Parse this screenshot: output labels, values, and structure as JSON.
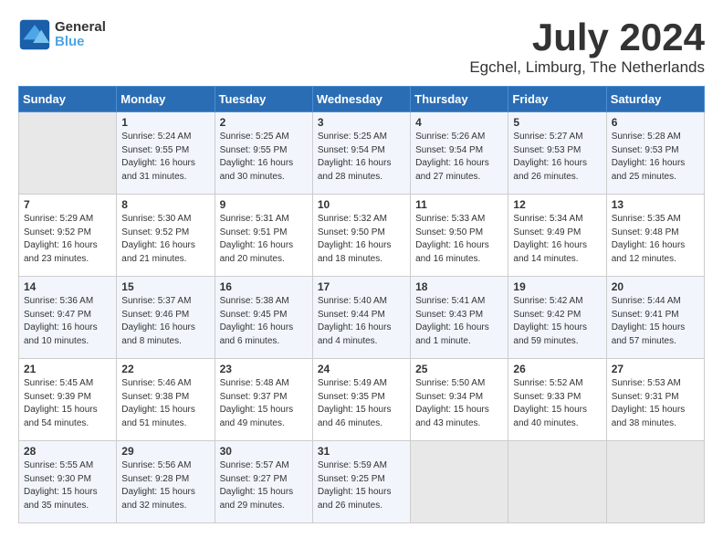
{
  "header": {
    "logo_line1": "General",
    "logo_line2": "Blue",
    "month_year": "July 2024",
    "location": "Egchel, Limburg, The Netherlands"
  },
  "days_of_week": [
    "Sunday",
    "Monday",
    "Tuesday",
    "Wednesday",
    "Thursday",
    "Friday",
    "Saturday"
  ],
  "weeks": [
    [
      {
        "day": "",
        "empty": true
      },
      {
        "day": "1",
        "sunrise": "5:24 AM",
        "sunset": "9:55 PM",
        "daylight": "16 hours and 31 minutes."
      },
      {
        "day": "2",
        "sunrise": "5:25 AM",
        "sunset": "9:55 PM",
        "daylight": "16 hours and 30 minutes."
      },
      {
        "day": "3",
        "sunrise": "5:25 AM",
        "sunset": "9:54 PM",
        "daylight": "16 hours and 28 minutes."
      },
      {
        "day": "4",
        "sunrise": "5:26 AM",
        "sunset": "9:54 PM",
        "daylight": "16 hours and 27 minutes."
      },
      {
        "day": "5",
        "sunrise": "5:27 AM",
        "sunset": "9:53 PM",
        "daylight": "16 hours and 26 minutes."
      },
      {
        "day": "6",
        "sunrise": "5:28 AM",
        "sunset": "9:53 PM",
        "daylight": "16 hours and 25 minutes."
      }
    ],
    [
      {
        "day": "7",
        "sunrise": "5:29 AM",
        "sunset": "9:52 PM",
        "daylight": "16 hours and 23 minutes."
      },
      {
        "day": "8",
        "sunrise": "5:30 AM",
        "sunset": "9:52 PM",
        "daylight": "16 hours and 21 minutes."
      },
      {
        "day": "9",
        "sunrise": "5:31 AM",
        "sunset": "9:51 PM",
        "daylight": "16 hours and 20 minutes."
      },
      {
        "day": "10",
        "sunrise": "5:32 AM",
        "sunset": "9:50 PM",
        "daylight": "16 hours and 18 minutes."
      },
      {
        "day": "11",
        "sunrise": "5:33 AM",
        "sunset": "9:50 PM",
        "daylight": "16 hours and 16 minutes."
      },
      {
        "day": "12",
        "sunrise": "5:34 AM",
        "sunset": "9:49 PM",
        "daylight": "16 hours and 14 minutes."
      },
      {
        "day": "13",
        "sunrise": "5:35 AM",
        "sunset": "9:48 PM",
        "daylight": "16 hours and 12 minutes."
      }
    ],
    [
      {
        "day": "14",
        "sunrise": "5:36 AM",
        "sunset": "9:47 PM",
        "daylight": "16 hours and 10 minutes."
      },
      {
        "day": "15",
        "sunrise": "5:37 AM",
        "sunset": "9:46 PM",
        "daylight": "16 hours and 8 minutes."
      },
      {
        "day": "16",
        "sunrise": "5:38 AM",
        "sunset": "9:45 PM",
        "daylight": "16 hours and 6 minutes."
      },
      {
        "day": "17",
        "sunrise": "5:40 AM",
        "sunset": "9:44 PM",
        "daylight": "16 hours and 4 minutes."
      },
      {
        "day": "18",
        "sunrise": "5:41 AM",
        "sunset": "9:43 PM",
        "daylight": "16 hours and 1 minute."
      },
      {
        "day": "19",
        "sunrise": "5:42 AM",
        "sunset": "9:42 PM",
        "daylight": "15 hours and 59 minutes."
      },
      {
        "day": "20",
        "sunrise": "5:44 AM",
        "sunset": "9:41 PM",
        "daylight": "15 hours and 57 minutes."
      }
    ],
    [
      {
        "day": "21",
        "sunrise": "5:45 AM",
        "sunset": "9:39 PM",
        "daylight": "15 hours and 54 minutes."
      },
      {
        "day": "22",
        "sunrise": "5:46 AM",
        "sunset": "9:38 PM",
        "daylight": "15 hours and 51 minutes."
      },
      {
        "day": "23",
        "sunrise": "5:48 AM",
        "sunset": "9:37 PM",
        "daylight": "15 hours and 49 minutes."
      },
      {
        "day": "24",
        "sunrise": "5:49 AM",
        "sunset": "9:35 PM",
        "daylight": "15 hours and 46 minutes."
      },
      {
        "day": "25",
        "sunrise": "5:50 AM",
        "sunset": "9:34 PM",
        "daylight": "15 hours and 43 minutes."
      },
      {
        "day": "26",
        "sunrise": "5:52 AM",
        "sunset": "9:33 PM",
        "daylight": "15 hours and 40 minutes."
      },
      {
        "day": "27",
        "sunrise": "5:53 AM",
        "sunset": "9:31 PM",
        "daylight": "15 hours and 38 minutes."
      }
    ],
    [
      {
        "day": "28",
        "sunrise": "5:55 AM",
        "sunset": "9:30 PM",
        "daylight": "15 hours and 35 minutes."
      },
      {
        "day": "29",
        "sunrise": "5:56 AM",
        "sunset": "9:28 PM",
        "daylight": "15 hours and 32 minutes."
      },
      {
        "day": "30",
        "sunrise": "5:57 AM",
        "sunset": "9:27 PM",
        "daylight": "15 hours and 29 minutes."
      },
      {
        "day": "31",
        "sunrise": "5:59 AM",
        "sunset": "9:25 PM",
        "daylight": "15 hours and 26 minutes."
      },
      {
        "day": "",
        "empty": true
      },
      {
        "day": "",
        "empty": true
      },
      {
        "day": "",
        "empty": true
      }
    ]
  ],
  "labels": {
    "sunrise_prefix": "Sunrise: ",
    "sunset_prefix": "Sunset: ",
    "daylight_prefix": "Daylight: "
  }
}
